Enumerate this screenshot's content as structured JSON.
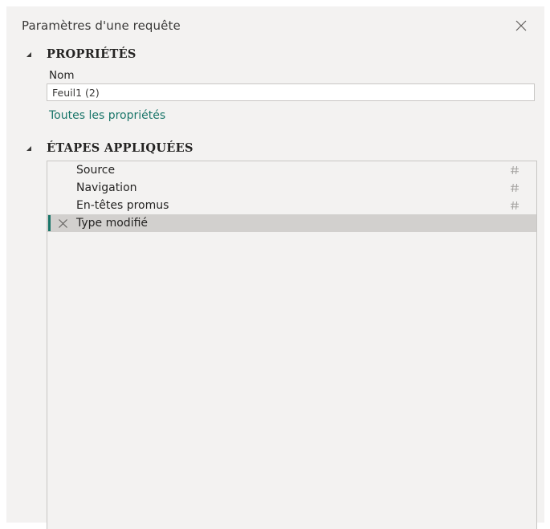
{
  "pane": {
    "title": "Paramètres d'une requête",
    "close_icon": "close-icon"
  },
  "properties": {
    "header": "PROPRIÉTÉS",
    "name_label": "Nom",
    "name_value": "Feuil1 (2)",
    "all_properties_link": "Toutes les propriétés"
  },
  "applied_steps": {
    "header": "ÉTAPES APPLIQUÉES",
    "selected_index": 3,
    "items": [
      {
        "label": "Source",
        "settings_icon": "gear-icon"
      },
      {
        "label": "Navigation",
        "settings_icon": "gear-icon"
      },
      {
        "label": "En-têtes promus",
        "settings_icon": "gear-icon"
      },
      {
        "label": "Type modifié",
        "delete_icon": "delete-step-icon"
      }
    ]
  },
  "colors": {
    "pane_background": "#f3f2f1",
    "selected_row": "#d2d0ce",
    "accent": "#197569",
    "border": "#c8c6c4"
  }
}
